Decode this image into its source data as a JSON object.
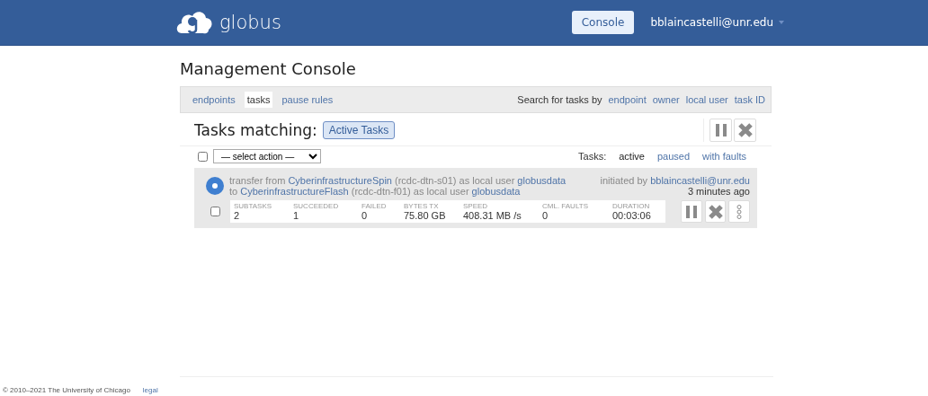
{
  "header": {
    "brand": "globus",
    "console_button": "Console",
    "user": "bblaincastelli@unr.edu"
  },
  "page_title": "Management Console",
  "nav": {
    "items": [
      {
        "label": "endpoints",
        "selected": false
      },
      {
        "label": "tasks",
        "selected": true
      },
      {
        "label": "pause rules",
        "selected": false
      }
    ],
    "search_label": "Search for tasks by",
    "search_links": [
      "endpoint",
      "owner",
      "local user",
      "task ID"
    ]
  },
  "tasks_heading": "Tasks matching:",
  "filter_badge": "Active Tasks",
  "toolbar": {
    "select_all_checked": false,
    "action_select": "— select action —",
    "tasks_label": "Tasks:",
    "filters": [
      {
        "label": "active",
        "selected": true
      },
      {
        "label": "paused",
        "selected": false
      },
      {
        "label": "with faults",
        "selected": false
      }
    ]
  },
  "task": {
    "checked": false,
    "lines": [
      [
        {
          "kind": "text",
          "text": "transfer from "
        },
        {
          "kind": "link",
          "text": "CyberinfrastructureSpin"
        },
        {
          "kind": "text",
          "text": " (rcdc-dtn-s01) as local user "
        },
        {
          "kind": "link",
          "text": "globusdata"
        }
      ],
      [
        {
          "kind": "text",
          "text": "to "
        },
        {
          "kind": "link",
          "text": "CyberinfrastructureFlash"
        },
        {
          "kind": "text",
          "text": " (rcdc-dtn-f01) as local user "
        },
        {
          "kind": "link",
          "text": "globusdata"
        }
      ]
    ],
    "initiated_label": "initiated by ",
    "initiated_by": "bblaincastelli@unr.edu",
    "age": "3 minutes ago",
    "stats": [
      {
        "label": "SUBTASKS",
        "value": "2"
      },
      {
        "label": "SUCCEEDED",
        "value": "1"
      },
      {
        "label": "FAILED",
        "value": "0"
      },
      {
        "label": "BYTES TX",
        "value": "75.80 GB"
      },
      {
        "label": "SPEED",
        "value": "408.31 MB /s"
      },
      {
        "label": "CML. FAULTS",
        "value": "0"
      },
      {
        "label": "DURATION",
        "value": "00:03:06"
      }
    ]
  },
  "footer": {
    "copyright": "© 2010–2021 The University of Chicago",
    "legal": "legal"
  }
}
